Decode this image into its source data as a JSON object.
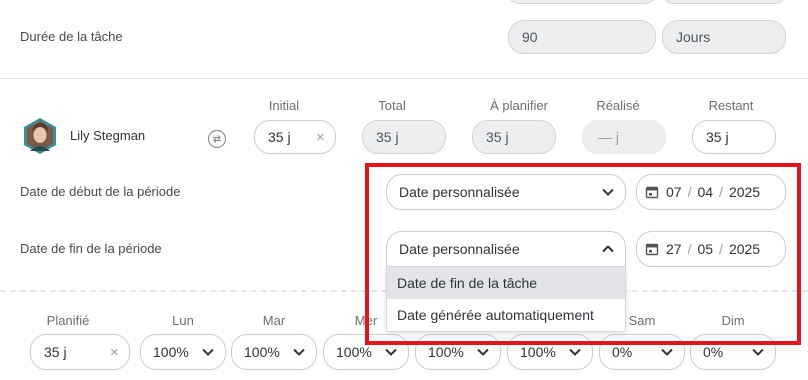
{
  "task_duration": {
    "label": "Durée de la tâche",
    "value": "90",
    "unit": "Jours"
  },
  "assignee": {
    "name": "Lily Stegman",
    "headers": {
      "initial": "Initial",
      "total": "Total",
      "to_plan": "À planifier",
      "done": "Réalisé",
      "remaining": "Restant"
    },
    "initial": "35 j",
    "total": "35 j",
    "to_plan": "35 j",
    "done": "— j",
    "remaining": "35 j"
  },
  "period_start": {
    "label": "Date de début de la période",
    "mode": "Date personnalisée",
    "day": "07",
    "month": "04",
    "year": "2025"
  },
  "period_end": {
    "label": "Date de fin de la période",
    "mode": "Date personnalisée",
    "day": "27",
    "month": "05",
    "year": "2025",
    "dropdown_options": [
      "Date de fin de la tâche",
      "Date générée automatiquement"
    ]
  },
  "weekly": {
    "headers": {
      "planned": "Planifié",
      "mon": "Lun",
      "tue": "Mar",
      "wed": "Mer",
      "sat": "Sam",
      "sun": "Dim"
    },
    "planned": "35 j",
    "mon": "100%",
    "tue": "100%",
    "wed": "100%",
    "thu": "100%",
    "fri": "100%",
    "sat": "0%",
    "sun": "0%"
  },
  "colors": {
    "highlight": "#e3141c",
    "border": "#c9cdd2",
    "disabled_bg": "#eceef0"
  }
}
